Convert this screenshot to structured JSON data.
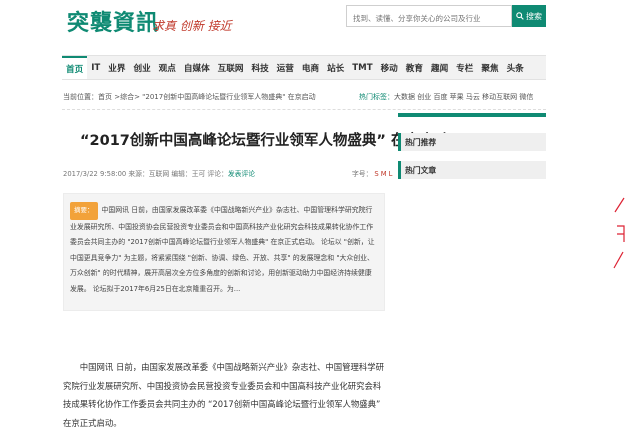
{
  "header": {
    "logo": "突襲資訊",
    "slogan": "求真 创新 接近",
    "search_placeholder": "找到、读懂、分享你关心的公司及行业",
    "search_button": "搜索"
  },
  "nav": {
    "items": [
      "首页",
      "IT",
      "业界",
      "创业",
      "观点",
      "自媒体",
      "互联网",
      "科技",
      "运营",
      "电商",
      "站长",
      "TMT",
      "移动",
      "教育",
      "趣闻",
      "专栏",
      "聚焦",
      "头条"
    ],
    "active_index": 0
  },
  "breadcrumb": {
    "text": "当前位置：首页 >综合> \"2017创新中国高峰论坛暨行业领军人物盛典\" 在京启动"
  },
  "hot_tags": {
    "label": "热门标签：",
    "tags": "大数据 创业 百度 苹果 马云 移动互联网 微信"
  },
  "article": {
    "title": "“2017创新中国高峰论坛暨行业领军人物盛典” 在京启动",
    "meta_prefix": "2017/3/22 9:58:00 来源：互联网  编辑：王可 评论：",
    "meta_link": "发表评论",
    "font_size_label": "字号：",
    "font_size_s": "S",
    "font_size_m": "M",
    "font_size_l": "L",
    "summary_tag": "摘要：",
    "summary": "中国网讯 日前，由国家发展改革委《中国战略新兴产业》杂志社、中国管理科学研究院行业发展研究所、中国投资协会民营投资专业委员会和中国高科技产业化研究会科技成果转化协作工作委员会共同主办的 \"2017创新中国高峰论坛暨行业领军人物盛典\" 在京正式启动。  论坛以 \"创新，让中国更具竞争力\" 为主题，将紧紧围绕 \"创新、协调、绿色、开放、共享\" 的发展理念和 \"大众创业、万众创新\" 的时代精神，展开高层次全方位多角度的创新和讨论，用创新驱动助力中国经济持续健康发展。   论坛拟于2017年6月25日在北京隆重召开。为...",
    "body": "中国网讯 日前，由国家发展改革委《中国战略新兴产业》杂志社、中国管理科学研究院行业发展研究所、中国投资协会民营投资专业委员会和中国高科技产业化研究会科技成果转化协作工作委员会共同主办的 “2017创新中国高峰论坛暨行业领军人物盛典” 在京正式启动。"
  },
  "sidebar": {
    "blocks": [
      "热门推荐",
      "热门文章"
    ]
  },
  "colors": {
    "brand": "#0f8a73",
    "accent_red": "#c0392b",
    "summary_tag": "#f2a23a"
  }
}
